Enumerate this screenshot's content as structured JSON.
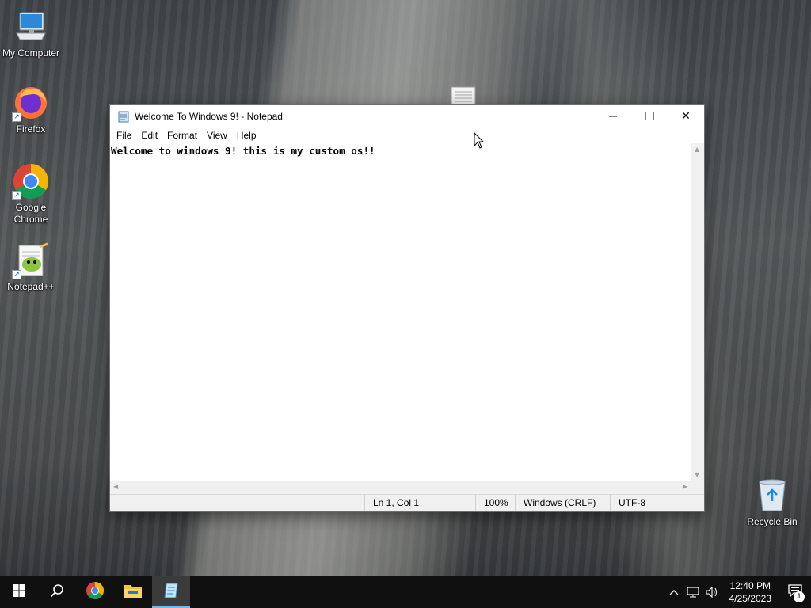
{
  "desktop": {
    "icons": [
      {
        "label": "My Computer",
        "icon": "computer-icon"
      },
      {
        "label": "Firefox",
        "icon": "firefox-icon"
      },
      {
        "label": "Google Chrome",
        "icon": "chrome-icon"
      },
      {
        "label": "Notepad++",
        "icon": "notepadpp-icon"
      },
      {
        "label": "Recycle Bin",
        "icon": "recycle-bin-icon"
      }
    ]
  },
  "window": {
    "title": "Welcome To Windows 9! - Notepad",
    "controls": {
      "minimize": "—",
      "maximize": "☐",
      "close": "✕"
    },
    "menu": [
      "File",
      "Edit",
      "Format",
      "View",
      "Help"
    ],
    "content": "Welcome to windows 9! this is my custom os!!",
    "status": {
      "position": "Ln 1, Col 1",
      "zoom": "100%",
      "line_ending": "Windows (CRLF)",
      "encoding": "UTF-8"
    }
  },
  "taskbar": {
    "pinned": [
      "start-icon",
      "search-icon",
      "chrome-icon",
      "file-explorer-icon",
      "notepad-icon"
    ],
    "active": "notepad-icon",
    "clock": {
      "time": "12:40 PM",
      "date": "4/25/2023"
    },
    "notification_count": "1"
  },
  "colors": {
    "taskbar_bg": "#101010",
    "active_indicator": "#76b9ed",
    "window_bg": "#ffffff"
  }
}
